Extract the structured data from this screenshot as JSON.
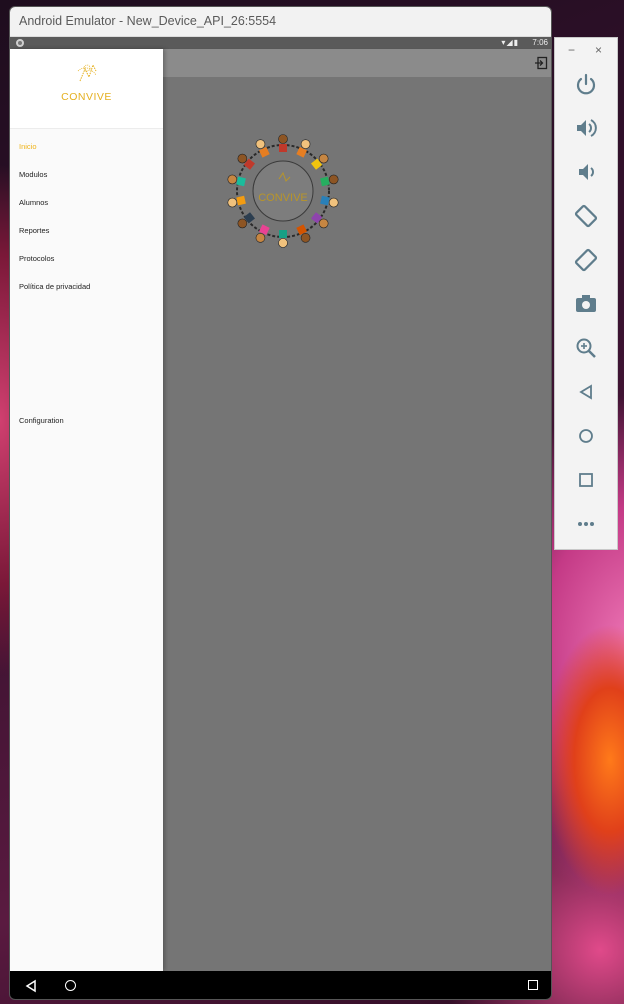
{
  "window": {
    "title": "Android Emulator - New_Device_API_26:5554"
  },
  "statusbar": {
    "time": "7:06",
    "icons": "▾◢▮"
  },
  "drawer": {
    "logo_text": "CONVIVE",
    "menu": [
      {
        "label": "Inicio",
        "active": true
      },
      {
        "label": "Modulos",
        "active": false
      },
      {
        "label": "Alumnos",
        "active": false
      },
      {
        "label": "Reportes",
        "active": false
      },
      {
        "label": "Protocolos",
        "active": false
      },
      {
        "label": "Política de privacidad",
        "active": false
      },
      {
        "label": "Configuration",
        "active": false
      }
    ]
  },
  "main": {
    "logo_text": "CONVIVE"
  },
  "side_panel": {
    "window_buttons": {
      "minimize": "−",
      "close": "×"
    },
    "buttons": [
      "power-icon",
      "volume-up-icon",
      "volume-down-icon",
      "rotate-left-icon",
      "rotate-right-icon",
      "camera-icon",
      "zoom-icon",
      "back-icon",
      "home-icon",
      "overview-icon",
      "more-icon"
    ]
  },
  "colors": {
    "accent": "#f0b41a",
    "scrim": "#757575",
    "drawer_bg": "#fafafa",
    "panel_icon": "#5f7d8c"
  }
}
